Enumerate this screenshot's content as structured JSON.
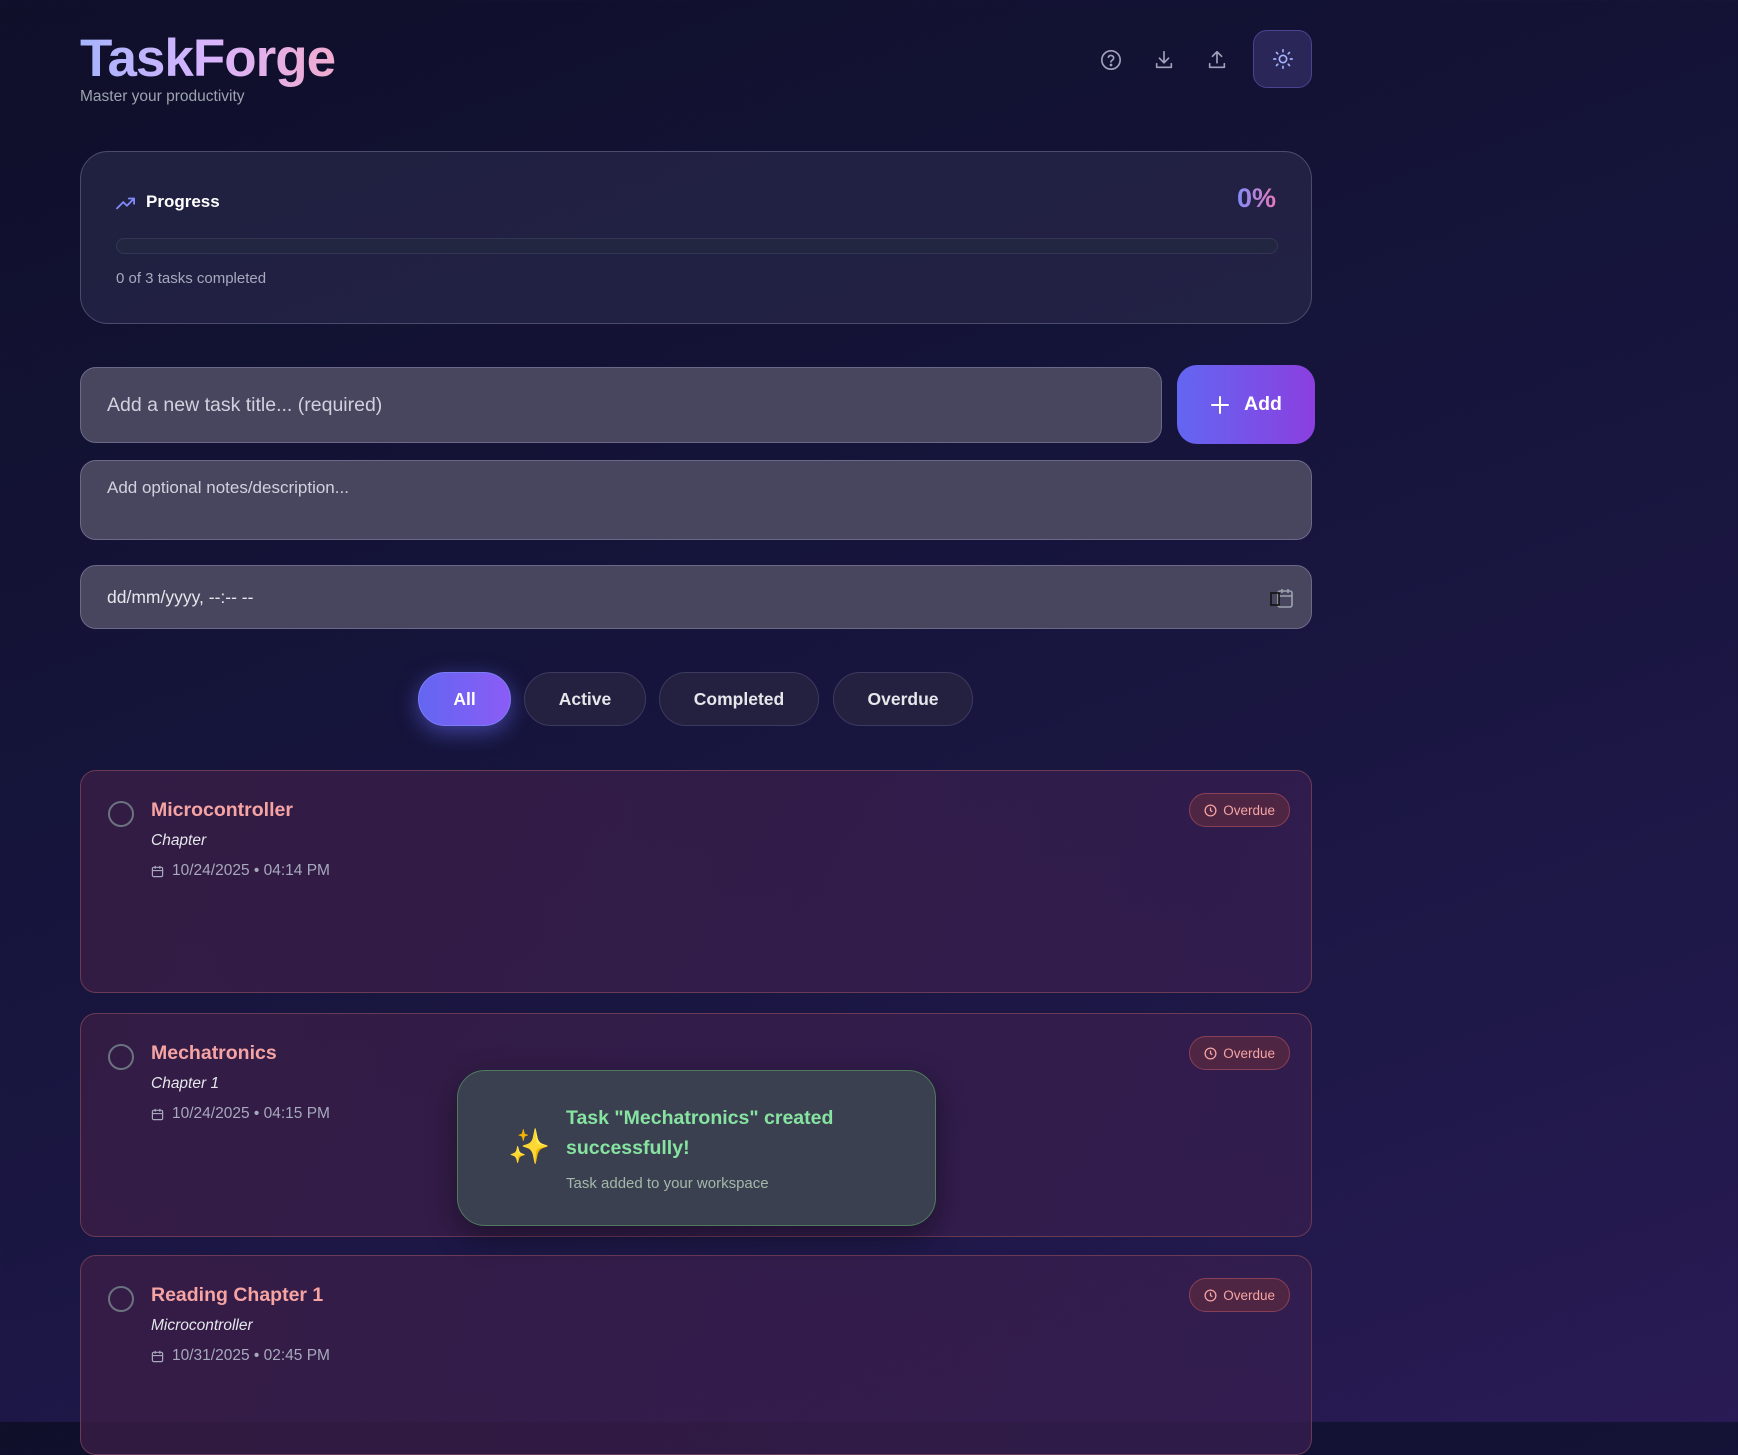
{
  "header": {
    "title": "TaskForge",
    "subtitle": "Master your productivity"
  },
  "progress": {
    "label": "Progress",
    "percent_text": "0%",
    "percent": 0,
    "summary": "0 of 3 tasks completed"
  },
  "form": {
    "title_placeholder": "Add a new task title... (required)",
    "notes_placeholder": "Add optional notes/description...",
    "date_placeholder": "dd/mm/yyyy, --:-- --",
    "add_label": "Add"
  },
  "filters": [
    {
      "label": "All",
      "active": true
    },
    {
      "label": "Active"
    },
    {
      "label": "Completed"
    },
    {
      "label": "Overdue"
    }
  ],
  "tasks": [
    {
      "title": "Microcontroller",
      "description": "Chapter",
      "date": "10/24/2025 • 04:14 PM",
      "status": "Overdue"
    },
    {
      "title": "Mechatronics",
      "description": "Chapter 1",
      "date": "10/24/2025 • 04:15 PM",
      "status": "Overdue"
    },
    {
      "title": "Reading Chapter 1",
      "description": "Microcontroller",
      "date": "10/31/2025 • 02:45 PM",
      "status": "Overdue"
    }
  ],
  "toast": {
    "icon": "✨",
    "title": "Task \"Mechatronics\" created successfully!",
    "message": "Task added to your workspace"
  }
}
